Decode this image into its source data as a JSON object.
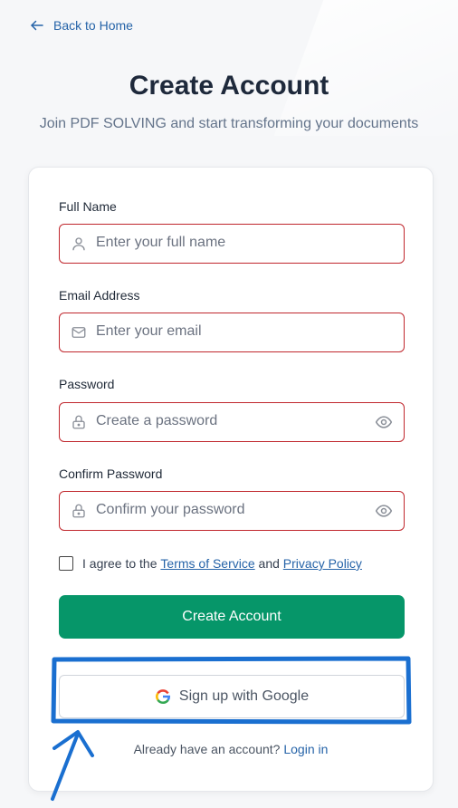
{
  "nav": {
    "back_label": "Back to Home"
  },
  "header": {
    "title": "Create Account",
    "subtitle": "Join PDF SOLVING and start transforming your documents"
  },
  "form": {
    "full_name": {
      "label": "Full Name",
      "placeholder": "Enter your full name",
      "icon": "user-icon"
    },
    "email": {
      "label": "Email Address",
      "placeholder": "Enter your email",
      "icon": "mail-icon"
    },
    "password": {
      "label": "Password",
      "placeholder": "Create a password",
      "icon": "lock-icon",
      "toggle_icon": "eye-icon"
    },
    "confirm_password": {
      "label": "Confirm Password",
      "placeholder": "Confirm your password",
      "icon": "lock-icon",
      "toggle_icon": "eye-icon"
    },
    "agree": {
      "prefix": "I agree to the",
      "terms": "Terms of Service",
      "and": "and",
      "privacy": "Privacy Policy",
      "checked": false
    },
    "submit_label": "Create Account",
    "google_label": "Sign up with Google",
    "login_prompt": "Already have an account?",
    "login_link": "Login in"
  },
  "colors": {
    "primary_green": "#069669",
    "error_border": "#c0272d",
    "link_blue": "#2563a8",
    "annotation_blue": "#1a6fd0"
  }
}
